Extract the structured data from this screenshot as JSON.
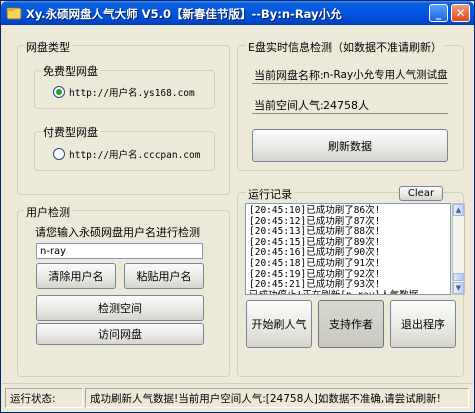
{
  "window": {
    "title": "Xy.永硕网盘人气大师 V5.0【新春佳节版】--By:n-Ray小允",
    "minimize_glyph": "_",
    "close_glyph": "✕"
  },
  "disk_type": {
    "group_label": "网盘类型",
    "free": {
      "label": "免费型网盘",
      "option": "http://用户名.ys168.com",
      "selected": true
    },
    "paid": {
      "label": "付费型网盘",
      "option": "http://用户名.cccpan.com",
      "selected": false
    }
  },
  "info": {
    "group_label": "E盘实时信息检测（如数据不准请刷新）",
    "current_disk_label": "当前网盘名称:",
    "current_disk_value": "n-Ray小允专用人气测试盘",
    "space_pop_label": "当前空间人气:",
    "space_pop_value": "24758人",
    "refresh_button": "刷新数据"
  },
  "user_check": {
    "group_label": "用户检测",
    "prompt": "请您输入永硕网盘用户名进行检测",
    "username_value": "n-ray",
    "clear_button": "清除用户名",
    "paste_button": "粘贴用户名",
    "check_button": "检测空间",
    "visit_button": "访问网盘"
  },
  "run_log": {
    "group_label": "运行记录",
    "clear_button": "Clear",
    "lines": [
      "[20:45:10]已成功刷了86次!",
      "[20:45:12]已成功刷了87次!",
      "[20:45:13]已成功刷了88次!",
      "[20:45:15]已成功刷了89次!",
      "[20:45:16]已成功刷了90次!",
      "[20:45:18]已成功刷了91次!",
      "[20:45:19]已成功刷了92次!",
      "[20:45:21]已成功刷了93次!",
      "已成功停止!正在刷新[n-ray]人气数据"
    ],
    "start_button": "开始刷人气",
    "support_button": "支持作者",
    "exit_button": "退出程序"
  },
  "status": {
    "label": "运行状态:",
    "message": "成功刷新人气数据!当前用户空间人气:[24758人]如数据不准确,请尝试刷新!"
  },
  "colors": {
    "titlebar": "#0055e5",
    "window_bg": "#ece9d8",
    "radio_dot": "#21a121"
  }
}
